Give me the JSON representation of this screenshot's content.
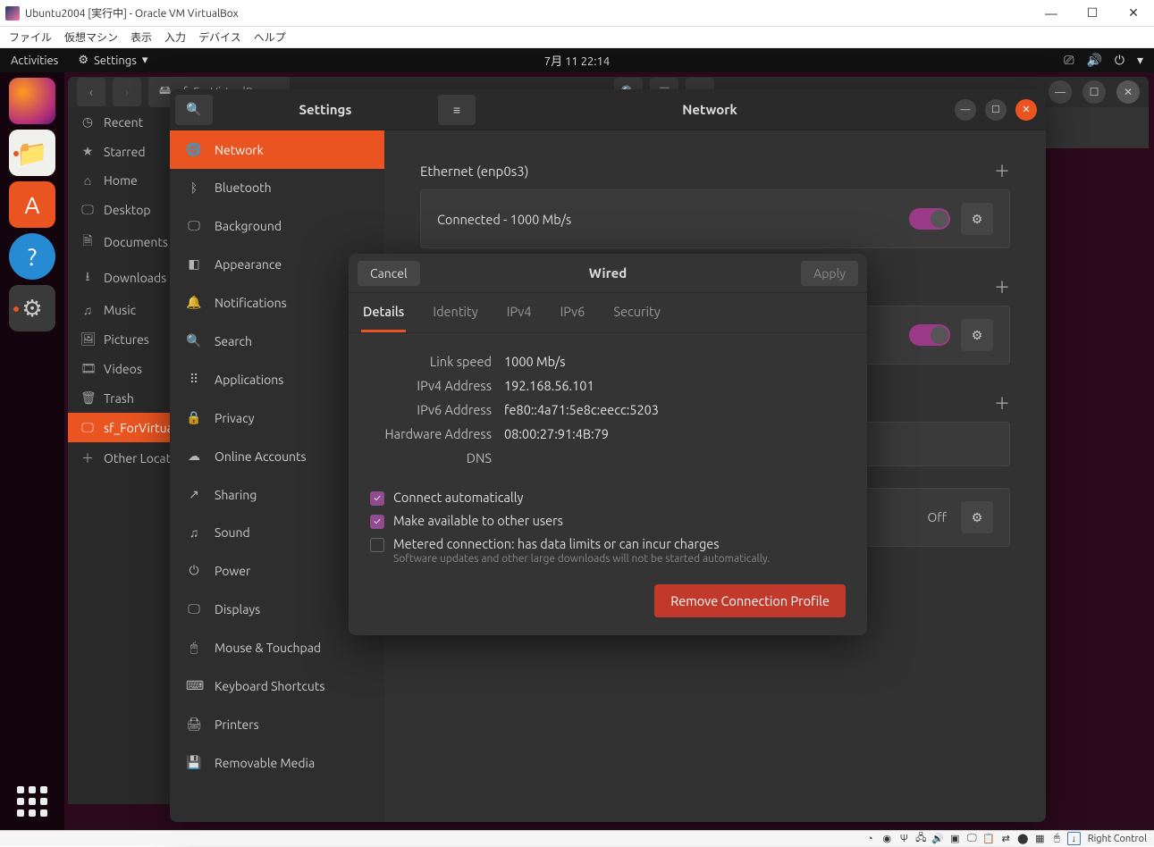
{
  "host_window": {
    "title": "Ubuntu2004 [実行中] - Oracle VM VirtualBox",
    "menus": [
      "ファイル",
      "仮想マシン",
      "表示",
      "入力",
      "デバイス",
      "ヘルプ"
    ],
    "status_host_key": "Right Control"
  },
  "topbar": {
    "activities": "Activities",
    "appmenu": "Settings",
    "clock": "7月 11  22:14"
  },
  "nautilus": {
    "path_label": "sf_ForVirtualBox",
    "side_items": [
      {
        "icon": "◷",
        "label": "Recent"
      },
      {
        "icon": "★",
        "label": "Starred"
      },
      {
        "icon": "⌂",
        "label": "Home"
      },
      {
        "icon": "🖵",
        "label": "Desktop"
      },
      {
        "icon": "🗎",
        "label": "Documents"
      },
      {
        "icon": "⭳",
        "label": "Downloads"
      },
      {
        "icon": "♫",
        "label": "Music"
      },
      {
        "icon": "🖼",
        "label": "Pictures"
      },
      {
        "icon": "🎞",
        "label": "Videos"
      },
      {
        "icon": "🗑",
        "label": "Trash"
      },
      {
        "icon": "🖵",
        "label": "sf_ForVirtualBox",
        "active": true
      },
      {
        "icon": "＋",
        "label": "Other Locations"
      }
    ]
  },
  "settings": {
    "title_left": "Settings",
    "title_right": "Network",
    "side_items": [
      {
        "icon": "🌐",
        "label": "Network",
        "active": true
      },
      {
        "icon": "ᛒ",
        "label": "Bluetooth"
      },
      {
        "icon": "🖵",
        "label": "Background"
      },
      {
        "icon": "◧",
        "label": "Appearance"
      },
      {
        "icon": "🔔",
        "label": "Notifications"
      },
      {
        "icon": "🔍",
        "label": "Search"
      },
      {
        "icon": "⠿",
        "label": "Applications"
      },
      {
        "icon": "🔒",
        "label": "Privacy"
      },
      {
        "icon": "☁",
        "label": "Online Accounts"
      },
      {
        "icon": "↗",
        "label": "Sharing"
      },
      {
        "icon": "♫",
        "label": "Sound"
      },
      {
        "icon": "⏻",
        "label": "Power"
      },
      {
        "icon": "🖵",
        "label": "Displays"
      },
      {
        "icon": "🖱",
        "label": "Mouse & Touchpad"
      },
      {
        "icon": "⌨",
        "label": "Keyboard Shortcuts"
      },
      {
        "icon": "🖨",
        "label": "Printers"
      },
      {
        "icon": "💾",
        "label": "Removable Media"
      }
    ],
    "ethernet": {
      "section": "Ethernet (enp0s3)",
      "status": "Connected - 1000 Mb/s"
    },
    "ethernet2_status": "",
    "network_proxy_off": "Off"
  },
  "wired": {
    "title": "Wired",
    "cancel": "Cancel",
    "apply": "Apply",
    "tabs": [
      "Details",
      "Identity",
      "IPv4",
      "IPv6",
      "Security"
    ],
    "details": {
      "link_speed_label": "Link speed",
      "link_speed": "1000 Mb/s",
      "ipv4_label": "IPv4 Address",
      "ipv4": "192.168.56.101",
      "ipv6_label": "IPv6 Address",
      "ipv6": "fe80::4a71:5e8c:eecc:5203",
      "hw_label": "Hardware Address",
      "hw": "08:00:27:91:4B:79",
      "dns_label": "DNS",
      "dns": ""
    },
    "chk1": "Connect automatically",
    "chk2": "Make available to other users",
    "chk3": "Metered connection: has data limits or can incur charges",
    "chk3sub": "Software updates and other large downloads will not be started automatically.",
    "remove": "Remove Connection Profile"
  }
}
